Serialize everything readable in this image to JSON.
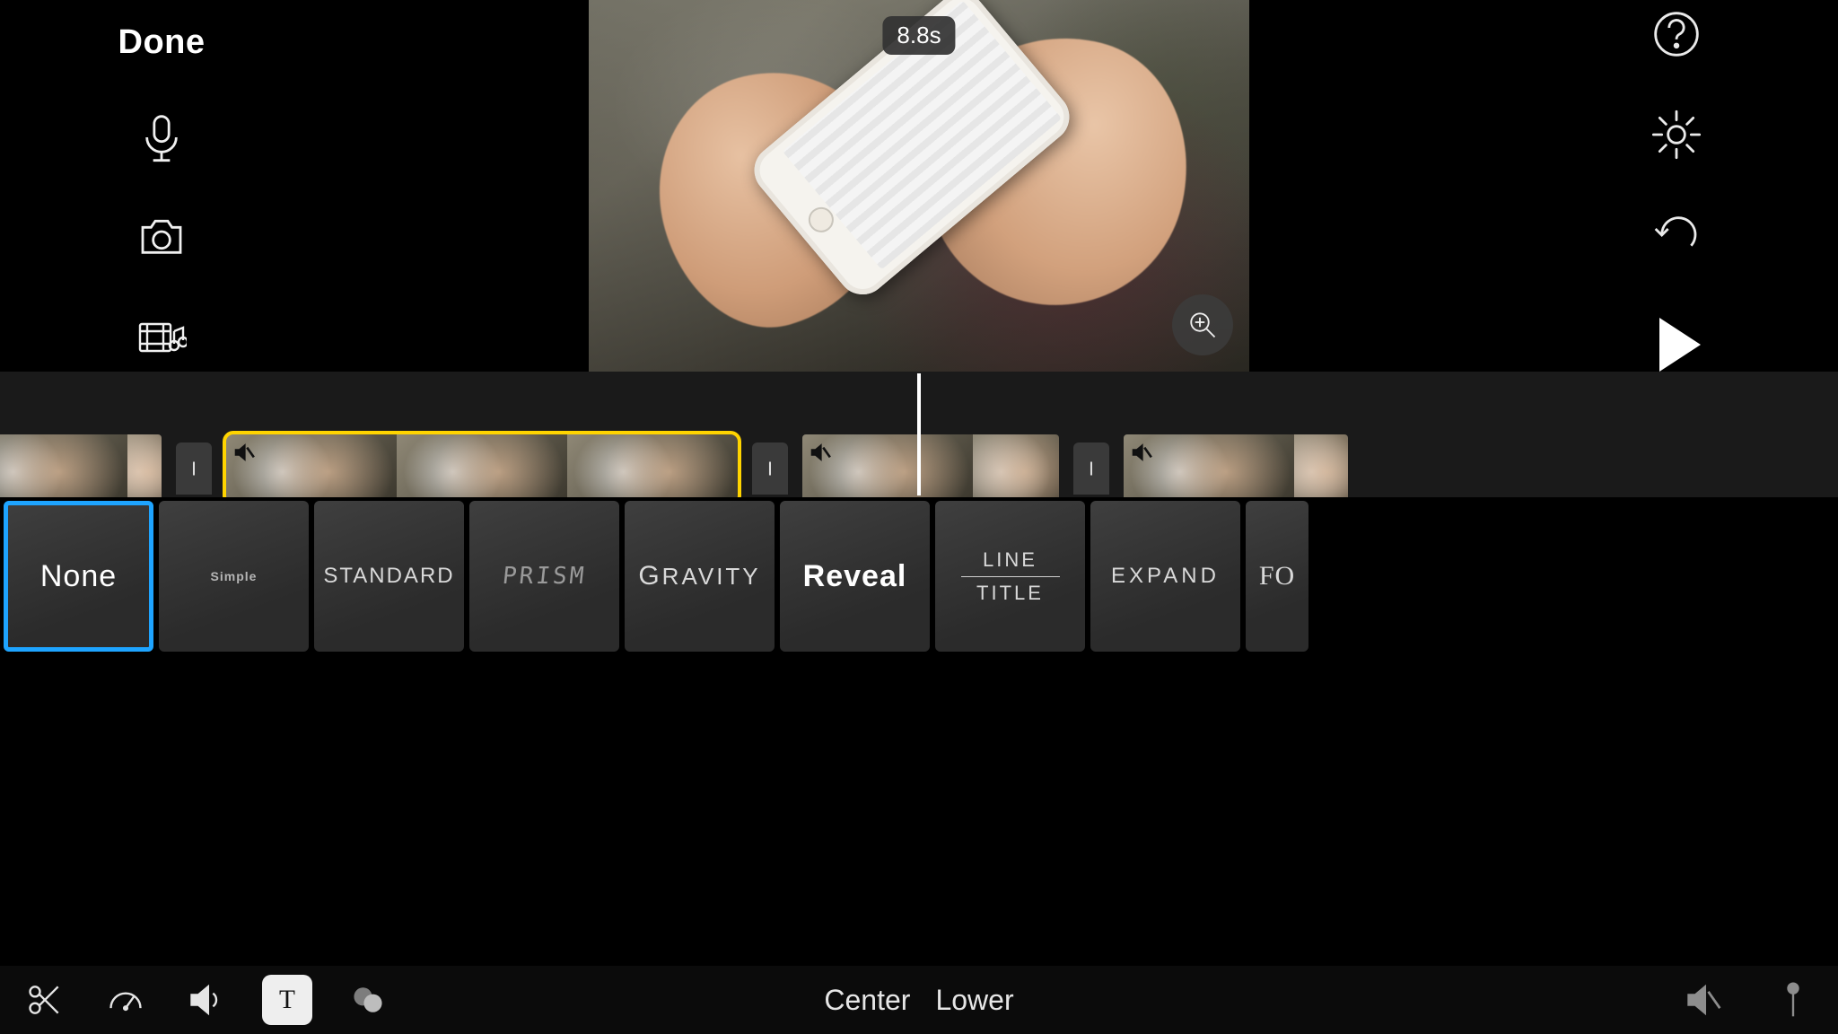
{
  "header": {
    "done": "Done"
  },
  "preview": {
    "duration": "8.8s"
  },
  "titles": {
    "items": [
      {
        "id": "none",
        "label": "None",
        "selected": true
      },
      {
        "id": "simple",
        "label": "Simple",
        "selected": false
      },
      {
        "id": "standard",
        "label": "STANDARD",
        "selected": false
      },
      {
        "id": "prism",
        "label": "PRISM",
        "selected": false
      },
      {
        "id": "gravity",
        "label": "GRAVITY",
        "selected": false
      },
      {
        "id": "reveal",
        "label": "Reveal",
        "selected": false
      },
      {
        "id": "line",
        "label_top": "LINE",
        "label_bottom": "TITLE",
        "selected": false
      },
      {
        "id": "expand",
        "label": "EXPAND",
        "selected": false
      },
      {
        "id": "focus",
        "label": "FO",
        "selected": false
      }
    ]
  },
  "title_position": {
    "center": "Center",
    "lower": "Lower"
  },
  "icons": {
    "mic": "microphone-icon",
    "camera": "camera-icon",
    "media": "media-library-icon",
    "help": "help-icon",
    "settings": "settings-icon",
    "undo": "undo-icon",
    "play": "play-icon",
    "zoom": "zoom-in-icon",
    "scissors": "split-icon",
    "speed": "speed-icon",
    "volume": "volume-icon",
    "text": "titles-icon",
    "filters": "filters-icon",
    "mute": "mute-speaker-icon",
    "pin": "pin-icon"
  }
}
